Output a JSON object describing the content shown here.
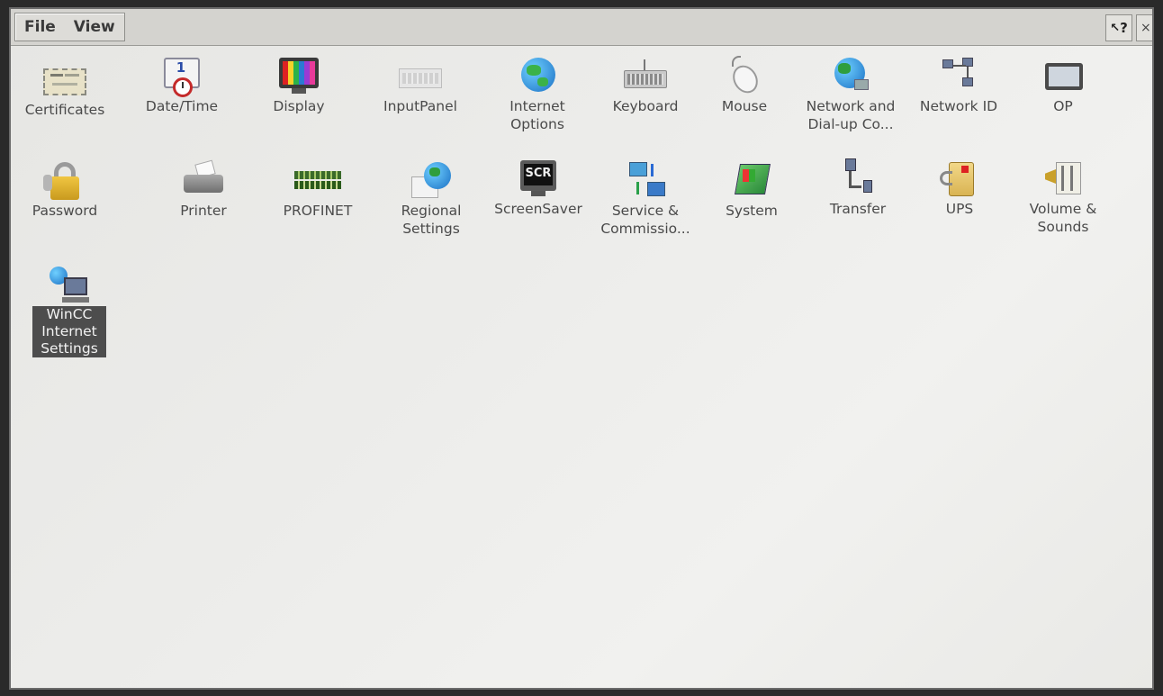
{
  "menubar": {
    "file": "File",
    "view": "View",
    "help": "?",
    "close": "×"
  },
  "icons": [
    {
      "label": "Certificates"
    },
    {
      "label": "Date/Time",
      "glyph": "1 2"
    },
    {
      "label": "Display"
    },
    {
      "label": "InputPanel"
    },
    {
      "label": "Internet Options"
    },
    {
      "label": "Keyboard"
    },
    {
      "label": "Mouse"
    },
    {
      "label": "Network and Dial-up Co..."
    },
    {
      "label": "Network ID"
    },
    {
      "label": "OP"
    },
    {
      "label": "Password"
    },
    {
      "label": "Printer"
    },
    {
      "label": "PROFINET"
    },
    {
      "label": "Regional Settings"
    },
    {
      "label": "ScreenSaver",
      "glyph": "SCR"
    },
    {
      "label": "Service & Commissio..."
    },
    {
      "label": "System"
    },
    {
      "label": "Transfer"
    },
    {
      "label": "UPS"
    },
    {
      "label": "Volume & Sounds"
    },
    {
      "label": "WinCC Internet Settings",
      "selected": true
    }
  ]
}
